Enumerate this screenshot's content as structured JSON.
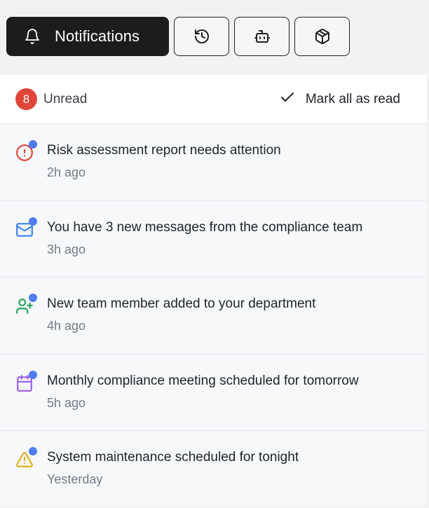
{
  "tabs": {
    "notifications_label": "Notifications",
    "history_icon": "history-icon",
    "bot_icon": "bot-icon",
    "package_icon": "package-icon"
  },
  "header": {
    "unread_count": "8",
    "unread_label": "Unread",
    "mark_all_label": "Mark all as read"
  },
  "notifications": [
    {
      "icon": "alert-circle-icon",
      "color": "#e0453a",
      "title": "Risk assessment report needs attention",
      "time": "2h ago",
      "unread": true
    },
    {
      "icon": "mail-icon",
      "color": "#3b82f6",
      "title": "You have 3 new messages from the compliance team",
      "time": "3h ago",
      "unread": true
    },
    {
      "icon": "user-plus-icon",
      "color": "#22a55a",
      "title": "New team member added to your department",
      "time": "4h ago",
      "unread": true
    },
    {
      "icon": "calendar-icon",
      "color": "#9b5de5",
      "title": "Monthly compliance meeting scheduled for tomorrow",
      "time": "5h ago",
      "unread": true
    },
    {
      "icon": "warning-triangle-icon",
      "color": "#e0b020",
      "title": "System maintenance scheduled for tonight",
      "time": "Yesterday",
      "unread": true
    }
  ],
  "colors": {
    "active_tab_bg": "#1c1c1c",
    "badge_bg": "#e0453a",
    "unread_dot": "#4f7cf0"
  }
}
